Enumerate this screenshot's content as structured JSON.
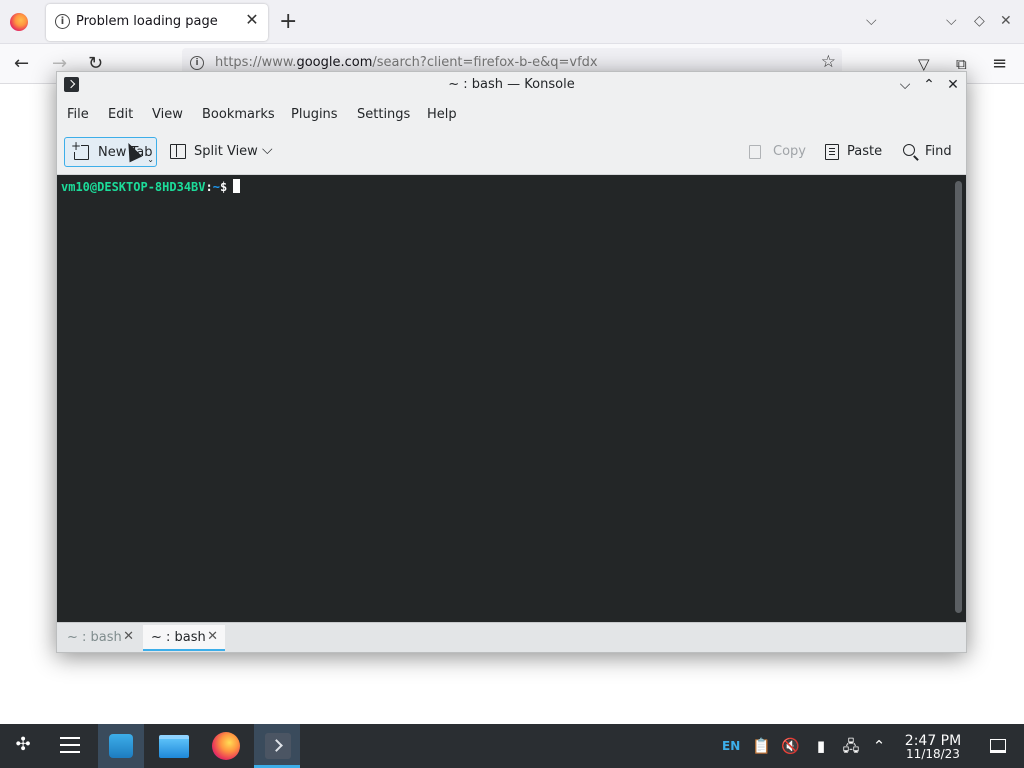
{
  "firefox": {
    "tab_title": "Problem loading page",
    "url_host": "https://www.",
    "url_domain": "google.com",
    "url_rest": "/search?client=firefox-b-e&q=vfdx"
  },
  "konsole": {
    "window_title": "~ : bash — Konsole",
    "menu": [
      "File",
      "Edit",
      "View",
      "Bookmarks",
      "Plugins",
      "Settings",
      "Help"
    ],
    "toolbar": {
      "new_tab": "New Tab",
      "split_view": "Split View",
      "copy": "Copy",
      "paste": "Paste",
      "find": "Find"
    },
    "terminal": {
      "user_host": "vm10@DESKTOP-8HD34BV",
      "separator": ":",
      "path": "~",
      "dollar": "$"
    },
    "tabs": [
      {
        "label": "~ : bash",
        "active": false
      },
      {
        "label": "~ : bash",
        "active": true
      }
    ]
  },
  "taskbar": {
    "language": "EN",
    "time": "2:47 PM",
    "date": "11/18/23"
  },
  "colors": {
    "accent": "#3daee9",
    "terminal_bg": "#232627",
    "prompt_user": "#1cdc9a",
    "prompt_path": "#1d99f3",
    "taskbar_bg": "#2a2e32"
  }
}
